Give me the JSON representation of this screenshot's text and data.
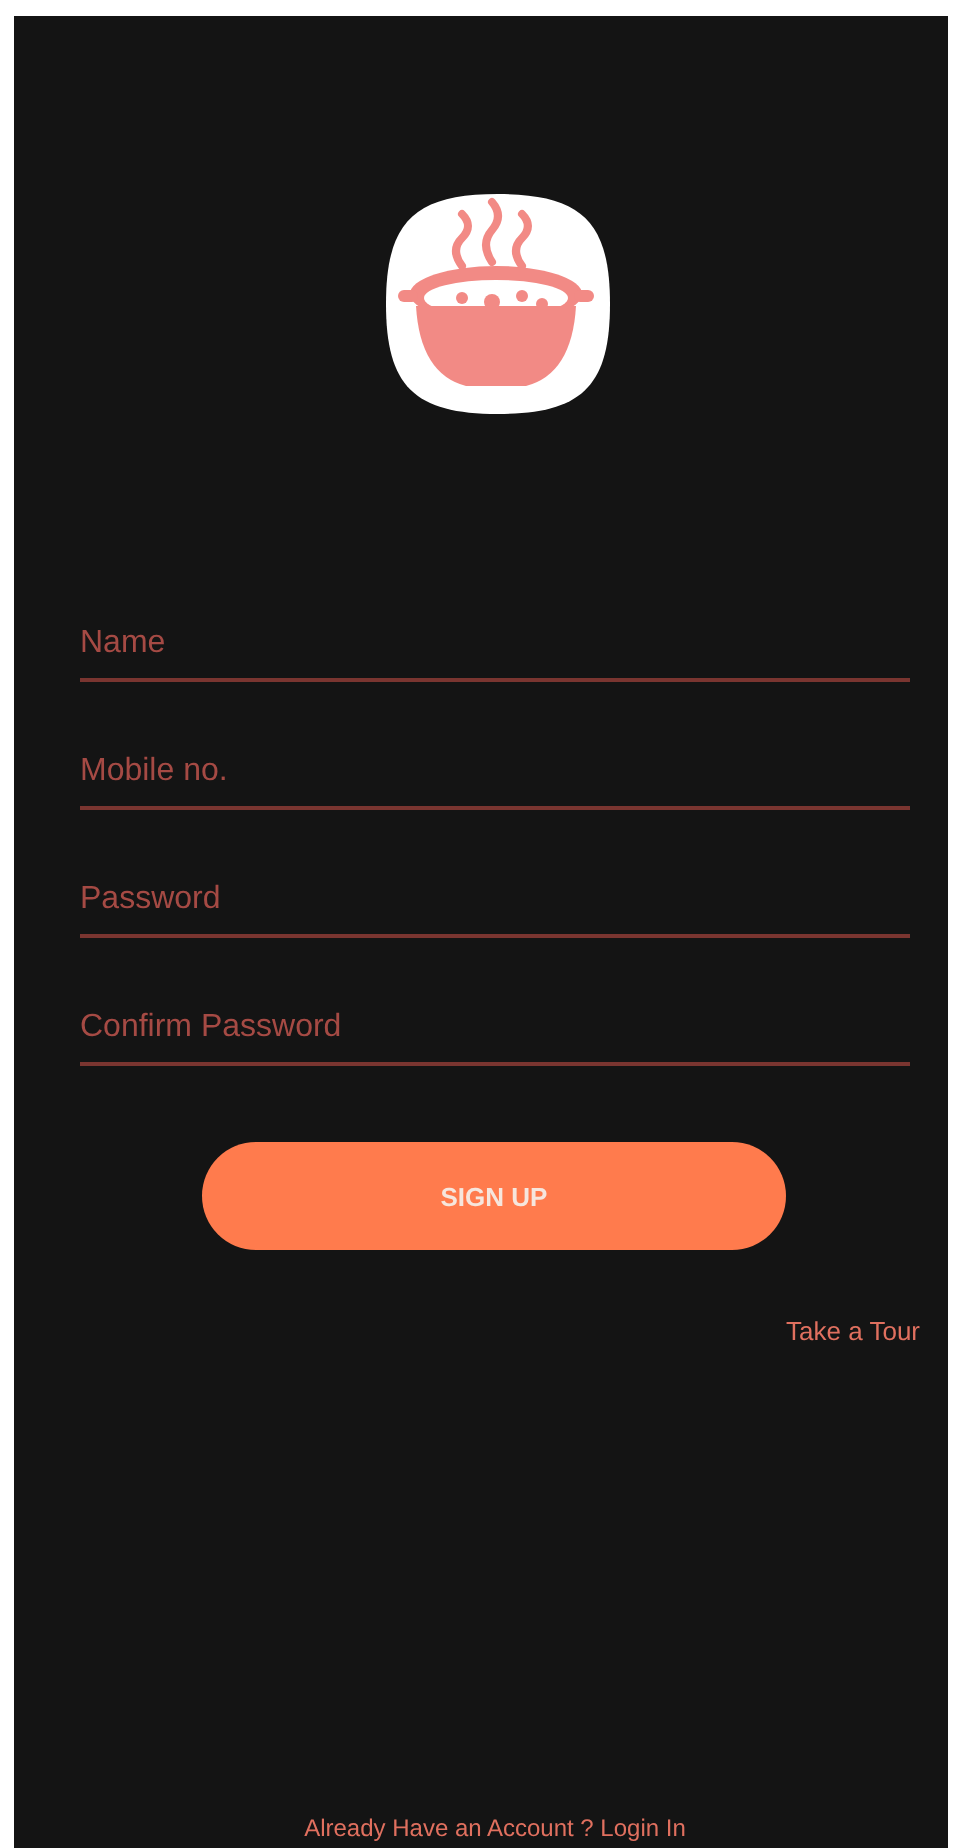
{
  "fields": [
    {
      "placeholder": "Name"
    },
    {
      "placeholder": "Mobile no."
    },
    {
      "placeholder": "Password"
    },
    {
      "placeholder": "Confirm Password"
    }
  ],
  "signup_button": "SIGN UP",
  "tour_link": "Take a Tour",
  "login_link": "Already Have an Account ? Login In"
}
